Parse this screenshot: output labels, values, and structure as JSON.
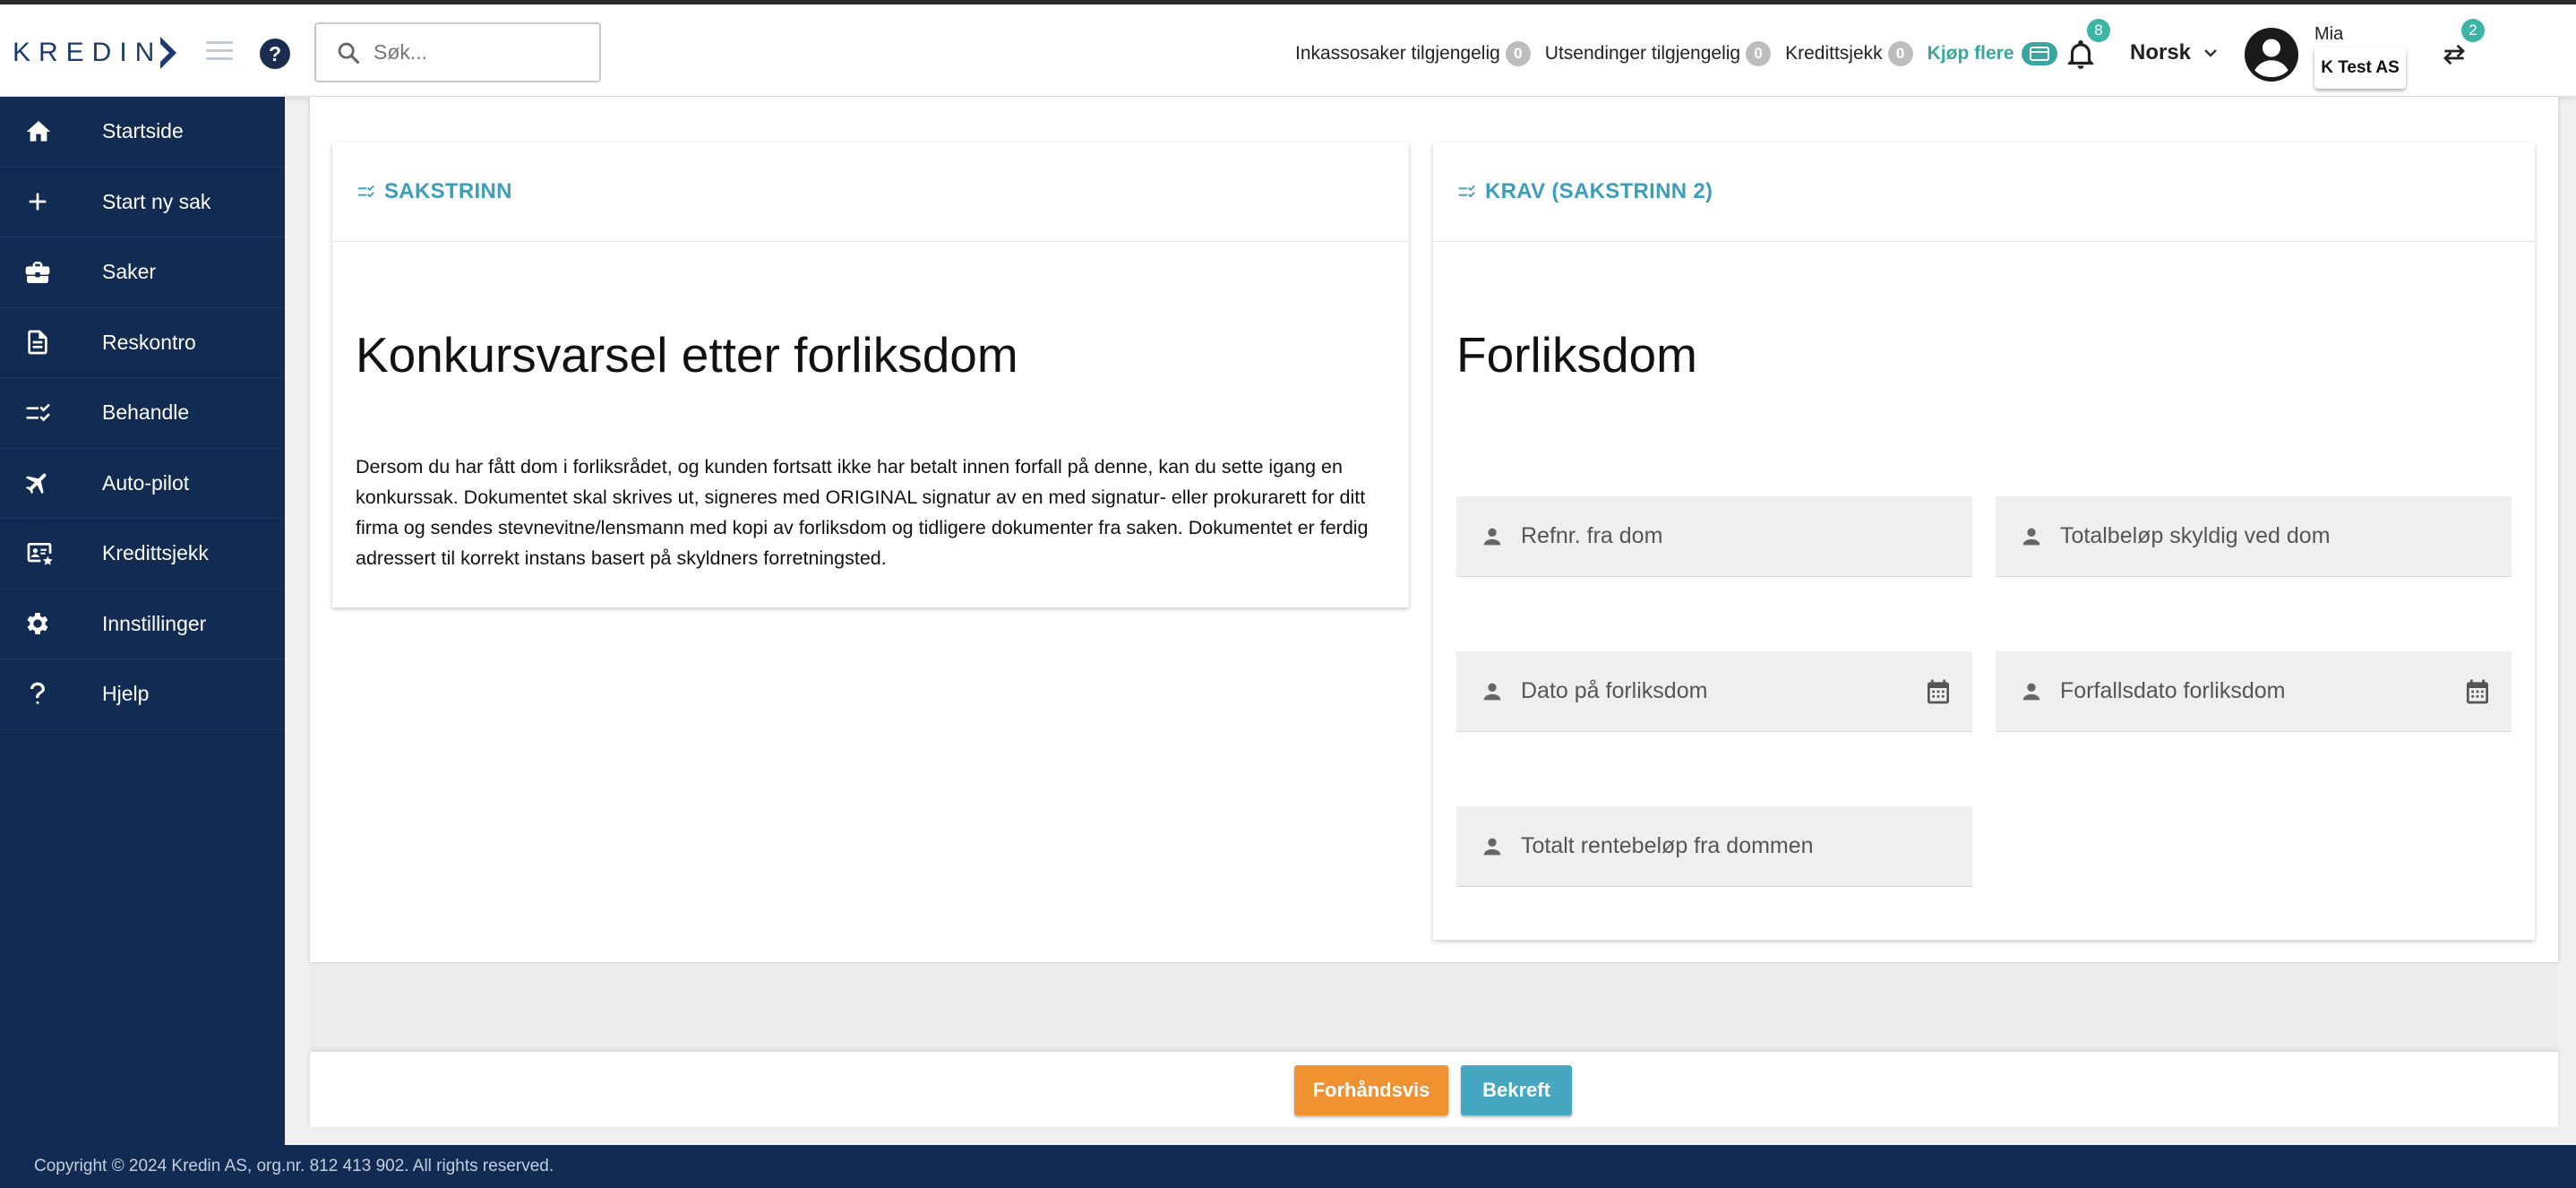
{
  "header": {
    "logo_text": "KREDIN",
    "search_placeholder": "Søk...",
    "counters": [
      {
        "label": "Inkassosaker tilgjengelig",
        "count": "0"
      },
      {
        "label": "Utsendinger tilgjengelig",
        "count": "0"
      },
      {
        "label": "Kredittsjekk",
        "count": "0"
      }
    ],
    "buy_more": "Kjøp flere",
    "notification_count": "8",
    "language": "Norsk",
    "user_name": "Mia",
    "company": "K Test AS",
    "switch_count": "2"
  },
  "sidebar": {
    "items": [
      {
        "label": "Startside",
        "icon": "home-icon"
      },
      {
        "label": "Start ny sak",
        "icon": "plus-icon"
      },
      {
        "label": "Saker",
        "icon": "briefcase-icon"
      },
      {
        "label": "Reskontro",
        "icon": "document-icon"
      },
      {
        "label": "Behandle",
        "icon": "checklist-icon"
      },
      {
        "label": "Auto-pilot",
        "icon": "airplane-icon"
      },
      {
        "label": "Kredittsjekk",
        "icon": "id-card-icon"
      },
      {
        "label": "Innstillinger",
        "icon": "gear-icon"
      },
      {
        "label": "Hjelp",
        "icon": "question-icon"
      }
    ]
  },
  "left_card": {
    "header": "SAKSTRINN",
    "title": "Konkursvarsel etter forliksdom",
    "description": "Dersom du har fått dom i forliksrådet, og kunden fortsatt ikke har betalt innen forfall på denne, kan du sette igang en konkurssak. Dokumentet skal skrives ut, signeres med ORIGINAL signatur av en med signatur- eller prokurarett for ditt firma og sendes stevnevitne/lensmann med kopi av forliksdom og tidligere dokumenter fra saken. Dokumentet er ferdig adressert til korrekt instans basert på skyldners forretningsted."
  },
  "right_card": {
    "header": "KRAV (SAKSTRINN 2)",
    "title": "Forliksdom",
    "fields": {
      "ref_no": "Refnr. fra dom",
      "total_owed": "Totalbeløp skyldig ved dom",
      "judgment_date": "Dato på forliksdom",
      "due_date": "Forfallsdato forliksdom",
      "total_interest": "Totalt rentebeløp fra dommen"
    }
  },
  "actions": {
    "preview": "Forhåndsvis",
    "confirm": "Bekreft"
  },
  "footer": {
    "copyright": "Copyright © 2024 Kredin AS, org.nr. 812 413 902. All rights reserved."
  },
  "colors": {
    "sidebar": "#122b53",
    "accent": "#3d9dbb",
    "preview_button": "#f0922f",
    "confirm_button": "#45a8c0",
    "badge": "#3db5a4"
  }
}
